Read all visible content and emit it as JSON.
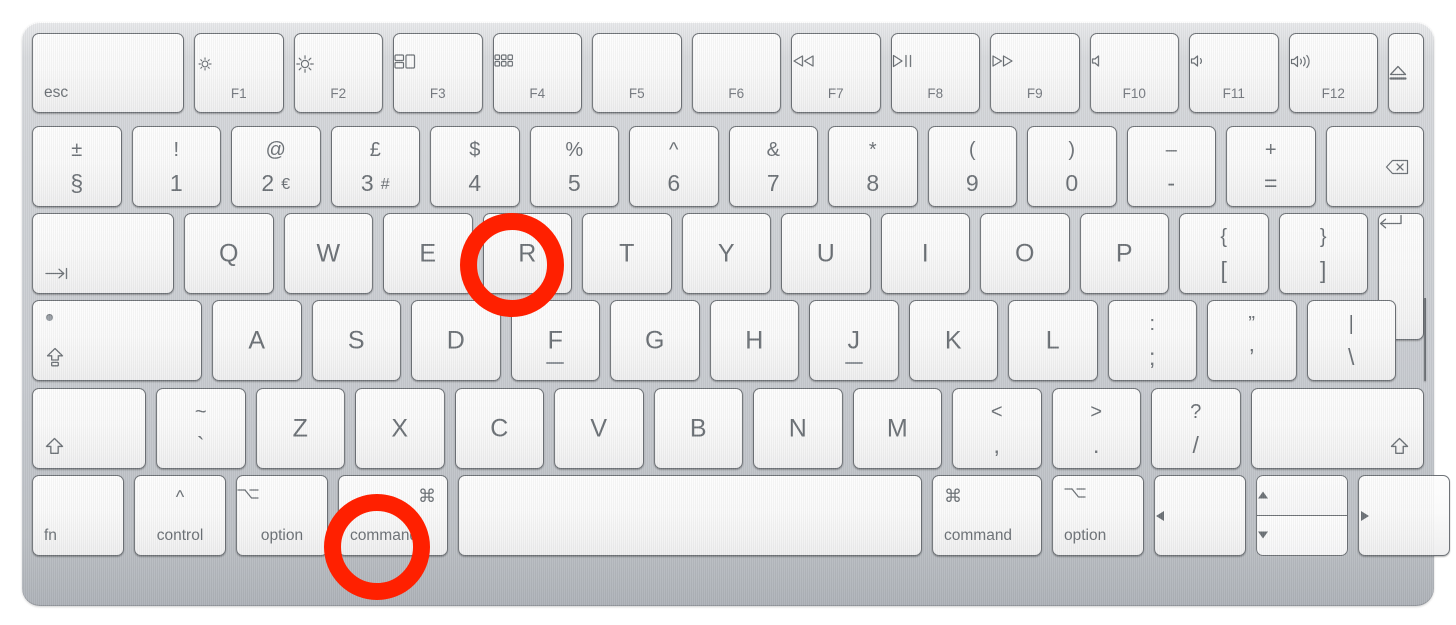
{
  "device": {
    "name": "Apple Magic Keyboard",
    "layout": "British (UK) ISO",
    "body_color": "#c9ccd1",
    "key_color": "#fafafa",
    "legend_color": "#6c7176"
  },
  "annotations": {
    "color": "#FF2000",
    "shape": "circle-outline",
    "stroke_px": 17,
    "targets": [
      {
        "key": "R",
        "label": "R"
      },
      {
        "key": "command-left",
        "label": "command"
      }
    ]
  },
  "rows": {
    "function_row": [
      {
        "id": "esc",
        "name": "escape-key",
        "main": "esc"
      },
      {
        "id": "f1",
        "name": "f1-brightness-down-key",
        "icon": "brightness-down-icon",
        "fname": "F1"
      },
      {
        "id": "f2",
        "name": "f2-brightness-up-key",
        "icon": "brightness-up-icon",
        "fname": "F2"
      },
      {
        "id": "f3",
        "name": "f3-mission-control-key",
        "icon": "mission-control-icon",
        "fname": "F3"
      },
      {
        "id": "f4",
        "name": "f4-launchpad-key",
        "icon": "launchpad-icon",
        "fname": "F4"
      },
      {
        "id": "f5",
        "name": "f5-key",
        "icon": "",
        "fname": "F5"
      },
      {
        "id": "f6",
        "name": "f6-key",
        "icon": "",
        "fname": "F6"
      },
      {
        "id": "f7",
        "name": "f7-rewind-key",
        "icon": "rewind-icon",
        "fname": "F7"
      },
      {
        "id": "f8",
        "name": "f8-play-pause-key",
        "icon": "play-pause-icon",
        "fname": "F8"
      },
      {
        "id": "f9",
        "name": "f9-fast-forward-key",
        "icon": "fast-forward-icon",
        "fname": "F9"
      },
      {
        "id": "f10",
        "name": "f10-mute-key",
        "icon": "volume-mute-icon",
        "fname": "F10"
      },
      {
        "id": "f11",
        "name": "f11-volume-down-key",
        "icon": "volume-down-icon",
        "fname": "F11"
      },
      {
        "id": "f12",
        "name": "f12-volume-up-key",
        "icon": "volume-up-icon",
        "fname": "F12"
      },
      {
        "id": "eject",
        "name": "eject-key",
        "icon": "eject-icon"
      }
    ],
    "number_row": [
      {
        "id": "section",
        "name": "section-key",
        "top": "±",
        "bottom": "§"
      },
      {
        "id": "1",
        "name": "digit-1-key",
        "top": "!",
        "bottom": "1"
      },
      {
        "id": "2",
        "name": "digit-2-key",
        "top": "@",
        "bottom": "2",
        "alt": "€"
      },
      {
        "id": "3",
        "name": "digit-3-key",
        "top": "£",
        "bottom": "3",
        "alt": "#"
      },
      {
        "id": "4",
        "name": "digit-4-key",
        "top": "$",
        "bottom": "4"
      },
      {
        "id": "5",
        "name": "digit-5-key",
        "top": "%",
        "bottom": "5"
      },
      {
        "id": "6",
        "name": "digit-6-key",
        "top": "^",
        "bottom": "6"
      },
      {
        "id": "7",
        "name": "digit-7-key",
        "top": "&",
        "bottom": "7"
      },
      {
        "id": "8",
        "name": "digit-8-key",
        "top": "*",
        "bottom": "8"
      },
      {
        "id": "9",
        "name": "digit-9-key",
        "top": "(",
        "bottom": "9"
      },
      {
        "id": "0",
        "name": "digit-0-key",
        "top": ")",
        "bottom": "0"
      },
      {
        "id": "minus",
        "name": "minus-key",
        "top": "–",
        "bottom": "-"
      },
      {
        "id": "equal",
        "name": "equals-key",
        "top": "+",
        "bottom": "="
      },
      {
        "id": "delete",
        "name": "delete-key",
        "icon": "delete-backward-icon"
      }
    ],
    "top_row": [
      {
        "id": "tab",
        "name": "tab-key",
        "icon": "tab-icon"
      },
      {
        "id": "q",
        "name": "q-key",
        "main": "Q"
      },
      {
        "id": "w",
        "name": "w-key",
        "main": "W"
      },
      {
        "id": "e",
        "name": "e-key",
        "main": "E"
      },
      {
        "id": "r",
        "name": "r-key",
        "main": "R",
        "annotated": true
      },
      {
        "id": "t",
        "name": "t-key",
        "main": "T"
      },
      {
        "id": "y",
        "name": "y-key",
        "main": "Y"
      },
      {
        "id": "u",
        "name": "u-key",
        "main": "U"
      },
      {
        "id": "i",
        "name": "i-key",
        "main": "I"
      },
      {
        "id": "o",
        "name": "o-key",
        "main": "O"
      },
      {
        "id": "p",
        "name": "p-key",
        "main": "P"
      },
      {
        "id": "lbracket",
        "name": "left-bracket-key",
        "top": "{",
        "bottom": "["
      },
      {
        "id": "rbracket",
        "name": "right-bracket-key",
        "top": "}",
        "bottom": "]"
      },
      {
        "id": "return",
        "name": "return-key",
        "icon": "return-icon"
      }
    ],
    "home_row": [
      {
        "id": "capslock",
        "name": "caps-lock-key",
        "icon": "caps-lock-icon",
        "indicator": true
      },
      {
        "id": "a",
        "name": "a-key",
        "main": "A"
      },
      {
        "id": "s",
        "name": "s-key",
        "main": "S"
      },
      {
        "id": "d",
        "name": "d-key",
        "main": "D"
      },
      {
        "id": "f",
        "name": "f-key",
        "main": "F",
        "homing": true
      },
      {
        "id": "g",
        "name": "g-key",
        "main": "G"
      },
      {
        "id": "h",
        "name": "h-key",
        "main": "H"
      },
      {
        "id": "j",
        "name": "j-key",
        "main": "J",
        "homing": true
      },
      {
        "id": "k",
        "name": "k-key",
        "main": "K"
      },
      {
        "id": "l",
        "name": "l-key",
        "main": "L"
      },
      {
        "id": "semicolon",
        "name": "semicolon-key",
        "top": ":",
        "bottom": ";"
      },
      {
        "id": "quote",
        "name": "quote-key",
        "top": "”",
        "bottom": "’"
      },
      {
        "id": "backslash",
        "name": "backslash-key",
        "top": "|",
        "bottom": "\\"
      }
    ],
    "bottom_letter_row": [
      {
        "id": "lshift",
        "name": "left-shift-key",
        "icon": "shift-icon"
      },
      {
        "id": "grave",
        "name": "grave-key",
        "top": "~",
        "bottom": "`"
      },
      {
        "id": "z",
        "name": "z-key",
        "main": "Z"
      },
      {
        "id": "x",
        "name": "x-key",
        "main": "X"
      },
      {
        "id": "c",
        "name": "c-key",
        "main": "C"
      },
      {
        "id": "v",
        "name": "v-key",
        "main": "V"
      },
      {
        "id": "b",
        "name": "b-key",
        "main": "B"
      },
      {
        "id": "n",
        "name": "n-key",
        "main": "N"
      },
      {
        "id": "m",
        "name": "m-key",
        "main": "M"
      },
      {
        "id": "comma",
        "name": "comma-key",
        "top": "<",
        "bottom": ","
      },
      {
        "id": "period",
        "name": "period-key",
        "top": ">",
        "bottom": "."
      },
      {
        "id": "slash",
        "name": "slash-key",
        "top": "?",
        "bottom": "/"
      },
      {
        "id": "rshift",
        "name": "right-shift-key",
        "icon": "shift-icon"
      }
    ],
    "modifier_row": [
      {
        "id": "fn",
        "name": "fn-key",
        "main": "fn"
      },
      {
        "id": "control",
        "name": "control-key",
        "symbol": "^",
        "word": "control"
      },
      {
        "id": "loption",
        "name": "left-option-key",
        "symbol": "option-icon",
        "word": "option"
      },
      {
        "id": "lcommand",
        "name": "left-command-key",
        "symbol": "⌘",
        "word": "command",
        "annotated": true
      },
      {
        "id": "space",
        "name": "space-bar",
        "word": ""
      },
      {
        "id": "rcommand",
        "name": "right-command-key",
        "symbol": "⌘",
        "word": "command"
      },
      {
        "id": "roption",
        "name": "right-option-key",
        "symbol": "option-icon",
        "word": "option"
      },
      {
        "id": "left",
        "name": "arrow-left-key",
        "icon": "arrow-left-icon"
      },
      {
        "id": "updown",
        "name": "arrow-up-down-keys",
        "icon_up": "arrow-up-icon",
        "icon_down": "arrow-down-icon"
      },
      {
        "id": "right",
        "name": "arrow-right-key",
        "icon": "arrow-right-icon"
      }
    ]
  }
}
